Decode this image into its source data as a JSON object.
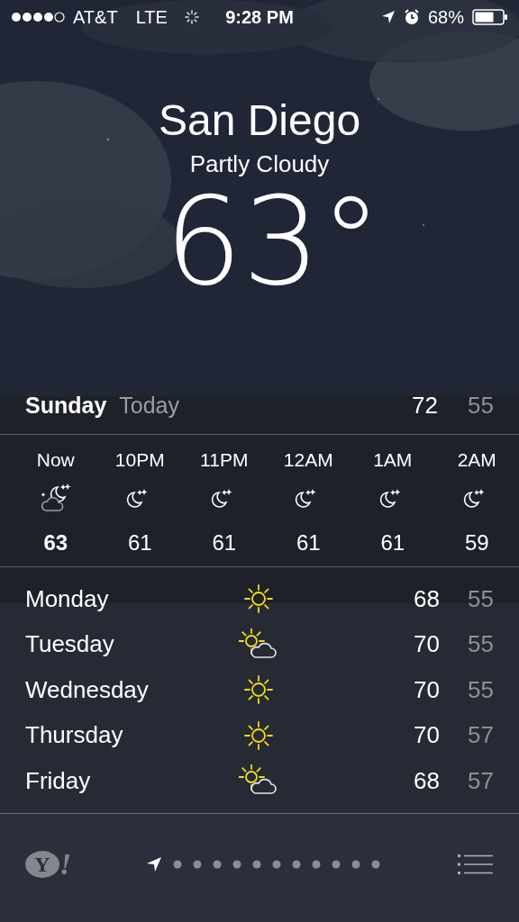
{
  "status_bar": {
    "carrier": "AT&T",
    "network": "LTE",
    "time": "9:28 PM",
    "battery": "68%"
  },
  "location": {
    "city": "San Diego",
    "condition": "Partly Cloudy",
    "temperature": "63°"
  },
  "today": {
    "day": "Sunday",
    "label": "Today",
    "high": "72",
    "low": "55"
  },
  "hourly": [
    {
      "time": "Now",
      "kind": "partly-cloudy-night",
      "temp": "63",
      "current": true
    },
    {
      "time": "10PM",
      "kind": "clear-night",
      "temp": "61",
      "current": false
    },
    {
      "time": "11PM",
      "kind": "clear-night",
      "temp": "61",
      "current": false
    },
    {
      "time": "12AM",
      "kind": "clear-night",
      "temp": "61",
      "current": false
    },
    {
      "time": "1AM",
      "kind": "clear-night",
      "temp": "61",
      "current": false
    },
    {
      "time": "2AM",
      "kind": "clear-night",
      "temp": "59",
      "current": false
    }
  ],
  "daily": [
    {
      "day": "Monday",
      "kind": "sunny",
      "high": "68",
      "low": "55"
    },
    {
      "day": "Tuesday",
      "kind": "partly-sunny",
      "high": "70",
      "low": "55"
    },
    {
      "day": "Wednesday",
      "kind": "sunny",
      "high": "70",
      "low": "55"
    },
    {
      "day": "Thursday",
      "kind": "sunny",
      "high": "70",
      "low": "57"
    },
    {
      "day": "Friday",
      "kind": "partly-sunny",
      "high": "68",
      "low": "57"
    }
  ],
  "toolbar": {
    "logo": {
      "letter": "Y",
      "mark": "!"
    },
    "pages": [
      {
        "kind": "location",
        "selected": true
      },
      {
        "kind": "dot",
        "selected": false
      },
      {
        "kind": "dot",
        "selected": false
      },
      {
        "kind": "dot",
        "selected": false
      },
      {
        "kind": "dot",
        "selected": false
      },
      {
        "kind": "dot",
        "selected": false
      },
      {
        "kind": "dot",
        "selected": false
      },
      {
        "kind": "dot",
        "selected": false
      },
      {
        "kind": "dot",
        "selected": false
      },
      {
        "kind": "dot",
        "selected": false
      },
      {
        "kind": "dot",
        "selected": false
      },
      {
        "kind": "dot",
        "selected": false
      }
    ]
  }
}
